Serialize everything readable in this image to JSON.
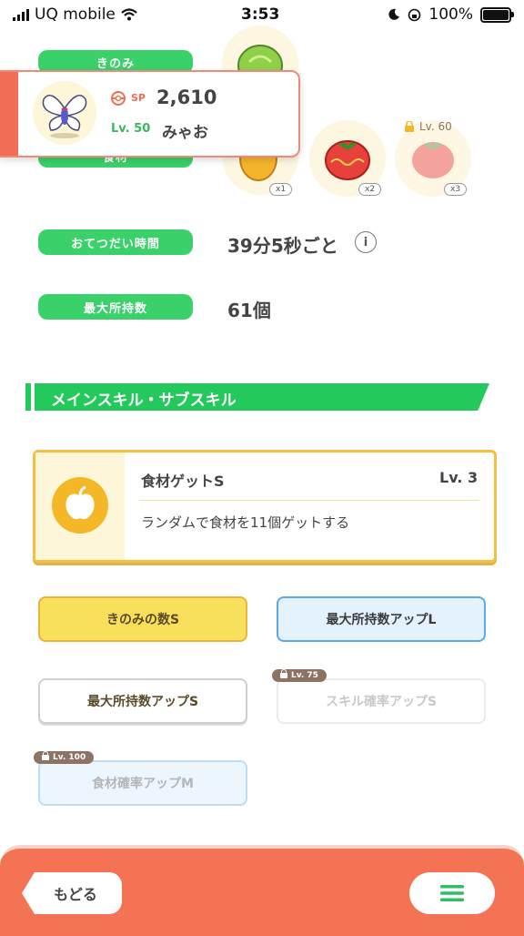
{
  "status_bar": {
    "carrier": "UQ mobile",
    "time": "3:53",
    "battery": "100%",
    "battery_level": 1.0
  },
  "pokemon": {
    "sp_label": "SP",
    "sp_value": "2,610",
    "level": "Lv. 50",
    "name": "みゃお"
  },
  "details": {
    "berry_label": "きのみ",
    "ingredient_label": "食材",
    "help_time_label": "おてつだい時間",
    "help_time_value": "39分5秒ごと",
    "max_carry_label": "最大所持数",
    "max_carry_value": "61個",
    "ingredients": [
      {
        "count": "x1",
        "color": "#f5b52a"
      },
      {
        "count": "x2",
        "color": "#e8413c"
      },
      {
        "count": "x3",
        "color": "#f29a92",
        "lock_level": "Lv. 60"
      }
    ]
  },
  "skills": {
    "section_title": "メインスキル・サブスキル",
    "main_skill": {
      "name": "食材ゲットS",
      "level": "Lv. 3",
      "description": "ランダムで食材を11個ゲットする"
    },
    "sub_skills": [
      {
        "label": "きのみの数S",
        "style": "gold"
      },
      {
        "label": "最大所持数アップL",
        "style": "blue"
      },
      {
        "label": "最大所持数アップS",
        "style": "white"
      },
      {
        "label": "スキル確率アップS",
        "style": "locked",
        "lock_level": "Lv. 75"
      },
      {
        "label": "食材確率アップM",
        "style": "locked-blue",
        "lock_level": "Lv. 100"
      }
    ]
  },
  "bottom_nav": {
    "back_label": "もどる",
    "menu_icon": "hamburger-icon"
  }
}
